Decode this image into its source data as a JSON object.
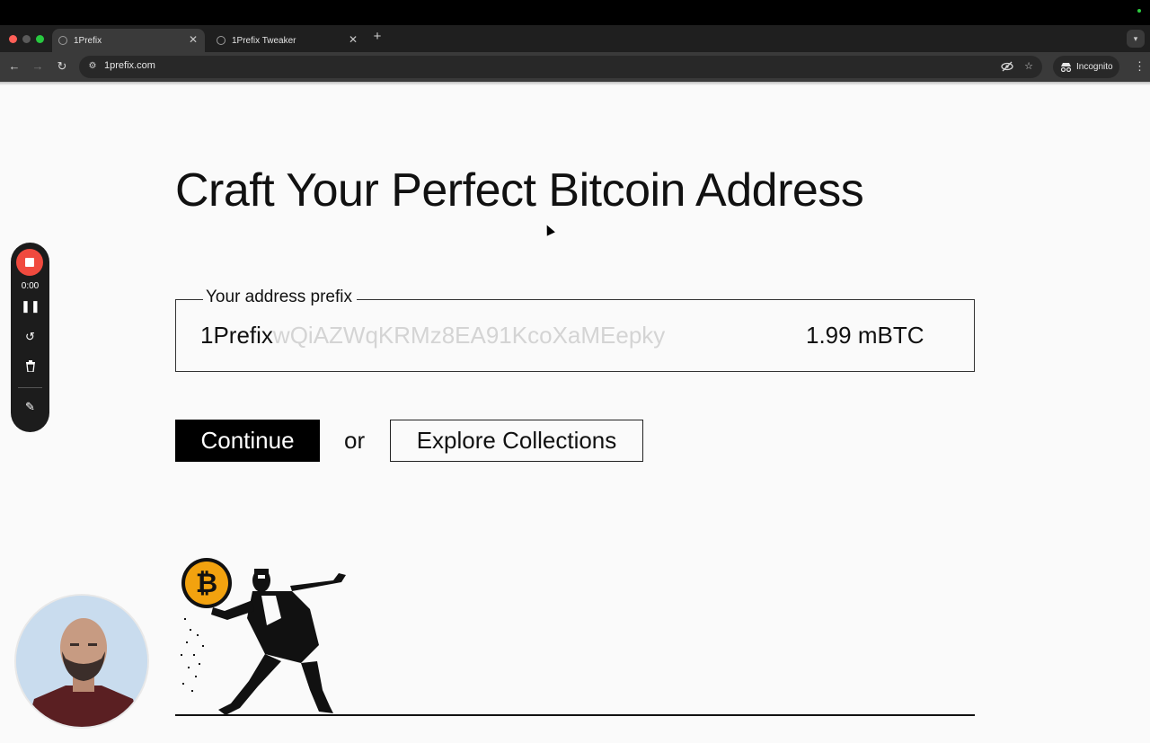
{
  "browser": {
    "tabs": [
      {
        "title": "1Prefix",
        "active": true
      },
      {
        "title": "1Prefix Tweaker",
        "active": false
      }
    ],
    "url": "1prefix.com",
    "incognito_label": "Incognito"
  },
  "page": {
    "title": "Craft Your Perfect Bitcoin Address",
    "field_legend": "Your address prefix",
    "prefix_value": "1Prefix",
    "address_suffix": "wQiAZWqKRMz8EA91KcoXaMEepky",
    "price": "1.99 mBTC",
    "continue_label": "Continue",
    "or_label": "or",
    "explore_label": "Explore Collections"
  },
  "recorder": {
    "time": "0:00"
  },
  "colors": {
    "record_red": "#f04a3e",
    "bitcoin_orange": "#f2a20f",
    "browser_dark": "#1f1f1f"
  },
  "icons": [
    "stop-icon",
    "pause-icon",
    "restart-icon",
    "trash-icon",
    "pen-icon",
    "eye-off-icon",
    "star-icon",
    "incognito-icon",
    "back-icon",
    "forward-icon",
    "reload-icon",
    "site-settings-icon"
  ]
}
